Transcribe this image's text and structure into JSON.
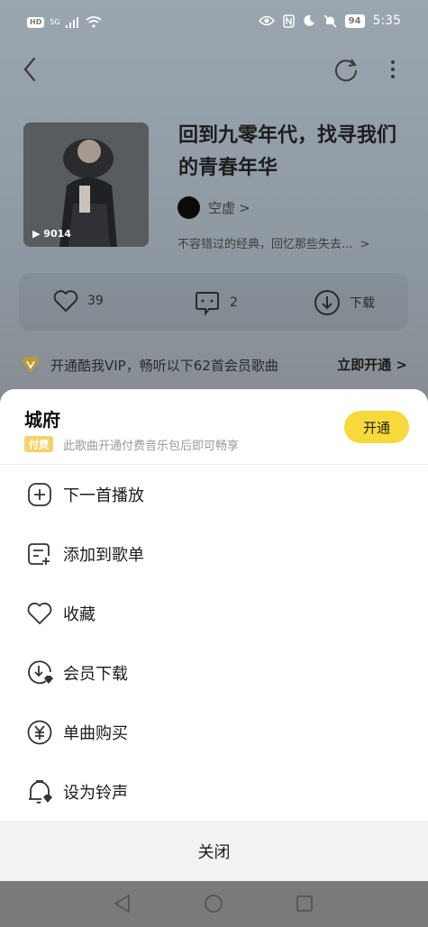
{
  "status_bar": {
    "hd": "HD",
    "network": "5G",
    "battery": "94",
    "time": "5:35"
  },
  "playlist": {
    "title": "回到九零年代，找寻我们的青春年华",
    "author": "空虚",
    "author_chevron": ">",
    "description": "不容错过的经典，回忆那些失去...",
    "description_chevron": ">",
    "play_count": "9014"
  },
  "actions": {
    "like_count": "39",
    "comment_count": "2",
    "download_label": "下载"
  },
  "vip_bar": {
    "text": "开通酷我VIP，畅听以下62首会员歌曲",
    "cta": "立即开通 >"
  },
  "sheet": {
    "song_title": "城府",
    "paid_badge": "付费",
    "paid_note": "此歌曲开通付费音乐包后即可畅享",
    "open_button": "开通",
    "menu": [
      {
        "label": "下一首播放",
        "icon": "play-next-icon"
      },
      {
        "label": "添加到歌单",
        "icon": "add-to-playlist-icon"
      },
      {
        "label": "收藏",
        "icon": "heart-icon"
      },
      {
        "label": "会员下载",
        "icon": "vip-download-icon"
      },
      {
        "label": "单曲购买",
        "icon": "yen-icon"
      },
      {
        "label": "设为铃声",
        "icon": "ringtone-bell-icon"
      }
    ],
    "close_label": "关闭"
  },
  "colors": {
    "accent_yellow": "#f6d93b",
    "badge_gold": "#f4d36a",
    "dim_overlay": "#7a7a7a"
  }
}
